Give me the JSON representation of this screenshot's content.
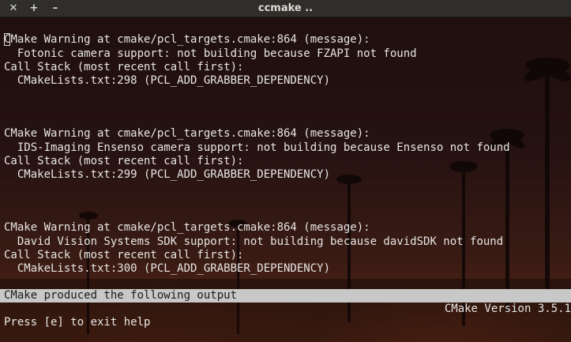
{
  "window": {
    "title": "ccmake ..",
    "close_glyph": "✕",
    "new_tab_glyph": "+",
    "minimize_glyph": "–"
  },
  "terminal": {
    "lines": [
      {
        "first_char": "C",
        "text": "Make Warning at cmake/pcl_targets.cmake:864 (message):"
      },
      {
        "first_char": "",
        "text": "  Fotonic camera support: not building because FZAPI not found"
      },
      {
        "first_char": "",
        "text": "Call Stack (most recent call first):"
      },
      {
        "first_char": "",
        "text": "  CMakeLists.txt:298 (PCL_ADD_GRABBER_DEPENDENCY)"
      },
      {
        "first_char": "",
        "text": "CMake Warning at cmake/pcl_targets.cmake:864 (message):"
      },
      {
        "first_char": "",
        "text": "  IDS-Imaging Ensenso camera support: not building because Ensenso not found"
      },
      {
        "first_char": "",
        "text": "Call Stack (most recent call first):"
      },
      {
        "first_char": "",
        "text": "  CMakeLists.txt:299 (PCL_ADD_GRABBER_DEPENDENCY)"
      },
      {
        "first_char": "",
        "text": "CMake Warning at cmake/pcl_targets.cmake:864 (message):"
      },
      {
        "first_char": "",
        "text": "  David Vision Systems SDK support: not building because davidSDK not found"
      },
      {
        "first_char": "",
        "text": "Call Stack (most recent call first):"
      },
      {
        "first_char": "",
        "text": "  CMakeLists.txt:300 (PCL_ADD_GRABBER_DEPENDENCY)"
      }
    ],
    "status_bar": "CMake produced the following output",
    "version": "CMake Version 3.5.1",
    "help": "Press [e] to exit help"
  },
  "colors": {
    "text": "#e8e6e3",
    "status_bar_bg": "#c8c8c8",
    "titlebar_bg": "#2f2e2b"
  }
}
